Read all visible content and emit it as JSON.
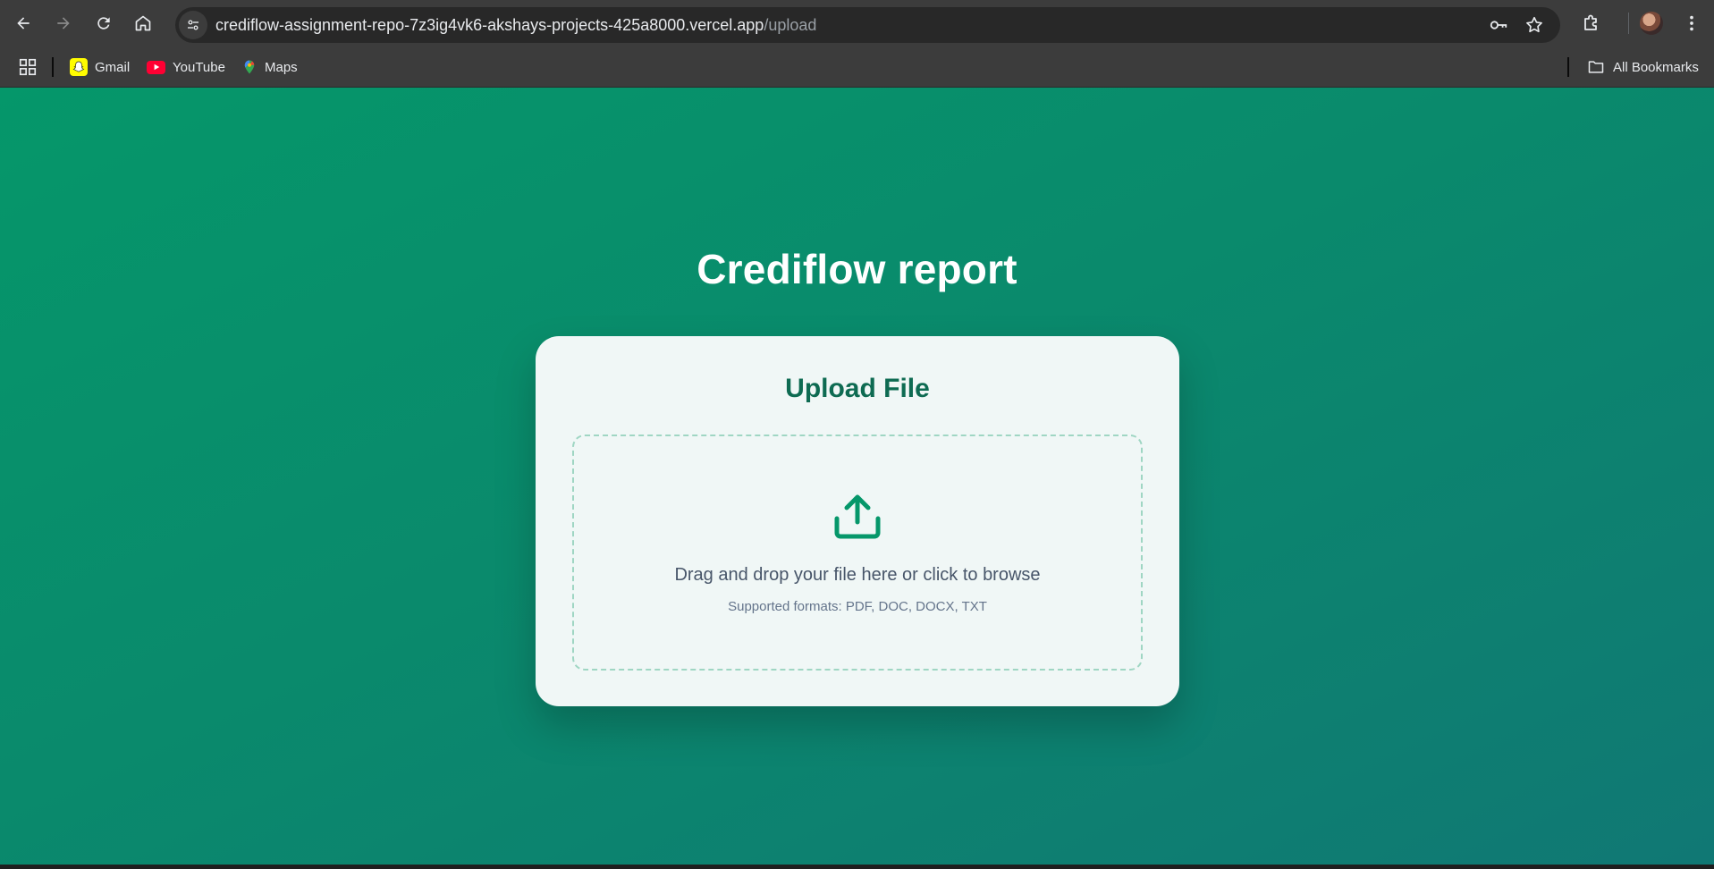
{
  "browser": {
    "url_host": "crediflow-assignment-repo-7z3ig4vk6-akshays-projects-425a8000.vercel.app",
    "url_path": "/upload",
    "bookmarks": [
      {
        "label": "Gmail",
        "icon": "snapchat-icon"
      },
      {
        "label": "YouTube",
        "icon": "youtube-icon"
      },
      {
        "label": "Maps",
        "icon": "maps-pin-icon"
      }
    ],
    "all_bookmarks_label": "All Bookmarks"
  },
  "page": {
    "title": "Crediflow report",
    "card": {
      "title": "Upload File",
      "drop_text": "Drag and drop your file here or click to browse",
      "formats_text": "Supported formats: PDF, DOC, DOCX, TXT"
    }
  },
  "colors": {
    "brand_green": "#05976a",
    "card_title": "#0e6b52",
    "dropzone_border": "#9fd6c3"
  }
}
